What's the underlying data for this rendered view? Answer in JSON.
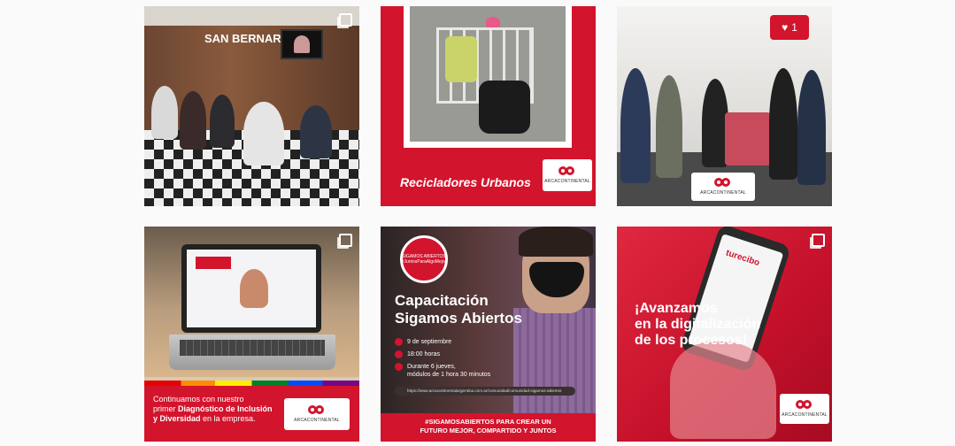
{
  "posts": [
    {
      "sign_small": "",
      "sign": "SAN BERNARDO",
      "multi": true
    },
    {
      "caption": "Recicladores Urbanos",
      "logo": "ARCACONTINENTAL"
    },
    {
      "likes": "1",
      "logo": "ARCACONTINENTAL"
    },
    {
      "caption_line1": "Continuamos con nuestro",
      "caption_pre": "primer ",
      "caption_bold": "Diagnóstico de Inclusión y Diversidad",
      "caption_post": " en la empresa.",
      "logo": "ARCACONTINENTAL",
      "multi": true
    },
    {
      "badge": "SIGAMOS ABIERTOS #JuntosParaAlgoMejor",
      "title_line1": "Capacitación",
      "title_line2": "Sigamos Abiertos",
      "date": "9 de septiembre",
      "time": "18:00 horas",
      "duration_line1": "Durante 6 jueves,",
      "duration_line2": "módulos de 1 hora 30 minutos",
      "url": "https://www.arcacontinentalargentina.com.ar/comunidad/comunidad-sigamos-abiertos",
      "bottom_line1": "#SIGAMOSABIERTOS PARA CREAR UN",
      "bottom_line2": "FUTURO MEJOR, COMPARTIDO Y JUNTOS"
    },
    {
      "title_line1": "¡Avanzamos",
      "title_line2": "en la digitalización",
      "title_line3": "de los procesos!",
      "phone_text": "turecibo",
      "logo": "ARCACONTINENTAL",
      "multi": true
    }
  ],
  "colors": {
    "brand_red": "#d3142d",
    "background": "#fafafa"
  }
}
